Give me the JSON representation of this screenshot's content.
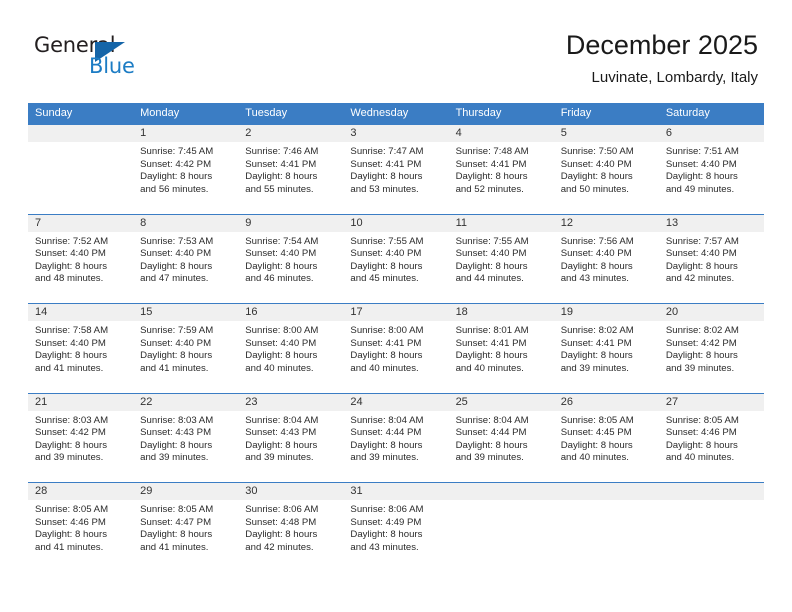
{
  "logo": {
    "primary_text": "General",
    "secondary_text": "Blue",
    "primary_color": "#231f20",
    "secondary_color": "#1c7cc4",
    "triangle_color": "#1565a8"
  },
  "header": {
    "title": "December 2025",
    "subtitle": "Luvinate, Lombardy, Italy"
  },
  "theme": {
    "header_row_background": "#3b7dc4",
    "header_row_text": "#ffffff",
    "day_band_background": "#f0f0f0",
    "grid_line": "#3b7dc4"
  },
  "weekdays": [
    "Sunday",
    "Monday",
    "Tuesday",
    "Wednesday",
    "Thursday",
    "Friday",
    "Saturday"
  ],
  "weeks": [
    [
      {
        "day": "",
        "empty": true,
        "sunrise": "",
        "sunset": "",
        "daylight_line1": "",
        "daylight_line2": ""
      },
      {
        "day": "1",
        "sunrise": "Sunrise: 7:45 AM",
        "sunset": "Sunset: 4:42 PM",
        "daylight_line1": "Daylight: 8 hours",
        "daylight_line2": "and 56 minutes."
      },
      {
        "day": "2",
        "sunrise": "Sunrise: 7:46 AM",
        "sunset": "Sunset: 4:41 PM",
        "daylight_line1": "Daylight: 8 hours",
        "daylight_line2": "and 55 minutes."
      },
      {
        "day": "3",
        "sunrise": "Sunrise: 7:47 AM",
        "sunset": "Sunset: 4:41 PM",
        "daylight_line1": "Daylight: 8 hours",
        "daylight_line2": "and 53 minutes."
      },
      {
        "day": "4",
        "sunrise": "Sunrise: 7:48 AM",
        "sunset": "Sunset: 4:41 PM",
        "daylight_line1": "Daylight: 8 hours",
        "daylight_line2": "and 52 minutes."
      },
      {
        "day": "5",
        "sunrise": "Sunrise: 7:50 AM",
        "sunset": "Sunset: 4:40 PM",
        "daylight_line1": "Daylight: 8 hours",
        "daylight_line2": "and 50 minutes."
      },
      {
        "day": "6",
        "sunrise": "Sunrise: 7:51 AM",
        "sunset": "Sunset: 4:40 PM",
        "daylight_line1": "Daylight: 8 hours",
        "daylight_line2": "and 49 minutes."
      }
    ],
    [
      {
        "day": "7",
        "sunrise": "Sunrise: 7:52 AM",
        "sunset": "Sunset: 4:40 PM",
        "daylight_line1": "Daylight: 8 hours",
        "daylight_line2": "and 48 minutes."
      },
      {
        "day": "8",
        "sunrise": "Sunrise: 7:53 AM",
        "sunset": "Sunset: 4:40 PM",
        "daylight_line1": "Daylight: 8 hours",
        "daylight_line2": "and 47 minutes."
      },
      {
        "day": "9",
        "sunrise": "Sunrise: 7:54 AM",
        "sunset": "Sunset: 4:40 PM",
        "daylight_line1": "Daylight: 8 hours",
        "daylight_line2": "and 46 minutes."
      },
      {
        "day": "10",
        "sunrise": "Sunrise: 7:55 AM",
        "sunset": "Sunset: 4:40 PM",
        "daylight_line1": "Daylight: 8 hours",
        "daylight_line2": "and 45 minutes."
      },
      {
        "day": "11",
        "sunrise": "Sunrise: 7:55 AM",
        "sunset": "Sunset: 4:40 PM",
        "daylight_line1": "Daylight: 8 hours",
        "daylight_line2": "and 44 minutes."
      },
      {
        "day": "12",
        "sunrise": "Sunrise: 7:56 AM",
        "sunset": "Sunset: 4:40 PM",
        "daylight_line1": "Daylight: 8 hours",
        "daylight_line2": "and 43 minutes."
      },
      {
        "day": "13",
        "sunrise": "Sunrise: 7:57 AM",
        "sunset": "Sunset: 4:40 PM",
        "daylight_line1": "Daylight: 8 hours",
        "daylight_line2": "and 42 minutes."
      }
    ],
    [
      {
        "day": "14",
        "sunrise": "Sunrise: 7:58 AM",
        "sunset": "Sunset: 4:40 PM",
        "daylight_line1": "Daylight: 8 hours",
        "daylight_line2": "and 41 minutes."
      },
      {
        "day": "15",
        "sunrise": "Sunrise: 7:59 AM",
        "sunset": "Sunset: 4:40 PM",
        "daylight_line1": "Daylight: 8 hours",
        "daylight_line2": "and 41 minutes."
      },
      {
        "day": "16",
        "sunrise": "Sunrise: 8:00 AM",
        "sunset": "Sunset: 4:40 PM",
        "daylight_line1": "Daylight: 8 hours",
        "daylight_line2": "and 40 minutes."
      },
      {
        "day": "17",
        "sunrise": "Sunrise: 8:00 AM",
        "sunset": "Sunset: 4:41 PM",
        "daylight_line1": "Daylight: 8 hours",
        "daylight_line2": "and 40 minutes."
      },
      {
        "day": "18",
        "sunrise": "Sunrise: 8:01 AM",
        "sunset": "Sunset: 4:41 PM",
        "daylight_line1": "Daylight: 8 hours",
        "daylight_line2": "and 40 minutes."
      },
      {
        "day": "19",
        "sunrise": "Sunrise: 8:02 AM",
        "sunset": "Sunset: 4:41 PM",
        "daylight_line1": "Daylight: 8 hours",
        "daylight_line2": "and 39 minutes."
      },
      {
        "day": "20",
        "sunrise": "Sunrise: 8:02 AM",
        "sunset": "Sunset: 4:42 PM",
        "daylight_line1": "Daylight: 8 hours",
        "daylight_line2": "and 39 minutes."
      }
    ],
    [
      {
        "day": "21",
        "sunrise": "Sunrise: 8:03 AM",
        "sunset": "Sunset: 4:42 PM",
        "daylight_line1": "Daylight: 8 hours",
        "daylight_line2": "and 39 minutes."
      },
      {
        "day": "22",
        "sunrise": "Sunrise: 8:03 AM",
        "sunset": "Sunset: 4:43 PM",
        "daylight_line1": "Daylight: 8 hours",
        "daylight_line2": "and 39 minutes."
      },
      {
        "day": "23",
        "sunrise": "Sunrise: 8:04 AM",
        "sunset": "Sunset: 4:43 PM",
        "daylight_line1": "Daylight: 8 hours",
        "daylight_line2": "and 39 minutes."
      },
      {
        "day": "24",
        "sunrise": "Sunrise: 8:04 AM",
        "sunset": "Sunset: 4:44 PM",
        "daylight_line1": "Daylight: 8 hours",
        "daylight_line2": "and 39 minutes."
      },
      {
        "day": "25",
        "sunrise": "Sunrise: 8:04 AM",
        "sunset": "Sunset: 4:44 PM",
        "daylight_line1": "Daylight: 8 hours",
        "daylight_line2": "and 39 minutes."
      },
      {
        "day": "26",
        "sunrise": "Sunrise: 8:05 AM",
        "sunset": "Sunset: 4:45 PM",
        "daylight_line1": "Daylight: 8 hours",
        "daylight_line2": "and 40 minutes."
      },
      {
        "day": "27",
        "sunrise": "Sunrise: 8:05 AM",
        "sunset": "Sunset: 4:46 PM",
        "daylight_line1": "Daylight: 8 hours",
        "daylight_line2": "and 40 minutes."
      }
    ],
    [
      {
        "day": "28",
        "sunrise": "Sunrise: 8:05 AM",
        "sunset": "Sunset: 4:46 PM",
        "daylight_line1": "Daylight: 8 hours",
        "daylight_line2": "and 41 minutes."
      },
      {
        "day": "29",
        "sunrise": "Sunrise: 8:05 AM",
        "sunset": "Sunset: 4:47 PM",
        "daylight_line1": "Daylight: 8 hours",
        "daylight_line2": "and 41 minutes."
      },
      {
        "day": "30",
        "sunrise": "Sunrise: 8:06 AM",
        "sunset": "Sunset: 4:48 PM",
        "daylight_line1": "Daylight: 8 hours",
        "daylight_line2": "and 42 minutes."
      },
      {
        "day": "31",
        "sunrise": "Sunrise: 8:06 AM",
        "sunset": "Sunset: 4:49 PM",
        "daylight_line1": "Daylight: 8 hours",
        "daylight_line2": "and 43 minutes."
      },
      {
        "day": "",
        "empty": true,
        "sunrise": "",
        "sunset": "",
        "daylight_line1": "",
        "daylight_line2": ""
      },
      {
        "day": "",
        "empty": true,
        "sunrise": "",
        "sunset": "",
        "daylight_line1": "",
        "daylight_line2": ""
      },
      {
        "day": "",
        "empty": true,
        "sunrise": "",
        "sunset": "",
        "daylight_line1": "",
        "daylight_line2": ""
      }
    ]
  ]
}
